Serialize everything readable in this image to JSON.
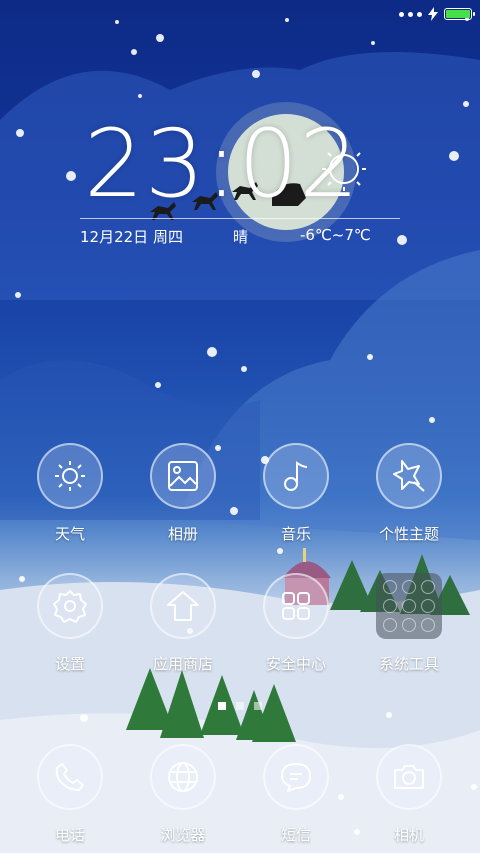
{
  "status": {
    "battery_color": "#45e04a",
    "battery_level": 1.0
  },
  "clock": {
    "time": "23:02"
  },
  "weather": {
    "date": "12月22日 周四",
    "condition": "晴",
    "temperature": "-6℃~7℃"
  },
  "apps": [
    {
      "label": "天气",
      "icon": "sun-icon"
    },
    {
      "label": "相册",
      "icon": "gallery-icon"
    },
    {
      "label": "音乐",
      "icon": "music-note-icon"
    },
    {
      "label": "个性主题",
      "icon": "theme-star-icon"
    },
    {
      "label": "设置",
      "icon": "gear-icon"
    },
    {
      "label": "应用商店",
      "icon": "app-store-icon"
    },
    {
      "label": "安全中心",
      "icon": "security-grid-icon"
    },
    {
      "label": "系统工具",
      "icon": "folder-icon"
    }
  ],
  "dock": [
    {
      "label": "电话",
      "icon": "phone-icon"
    },
    {
      "label": "浏览器",
      "icon": "globe-icon"
    },
    {
      "label": "短信",
      "icon": "message-icon"
    },
    {
      "label": "相机",
      "icon": "camera-icon"
    }
  ],
  "pager": {
    "pages": 3,
    "current": 1
  }
}
